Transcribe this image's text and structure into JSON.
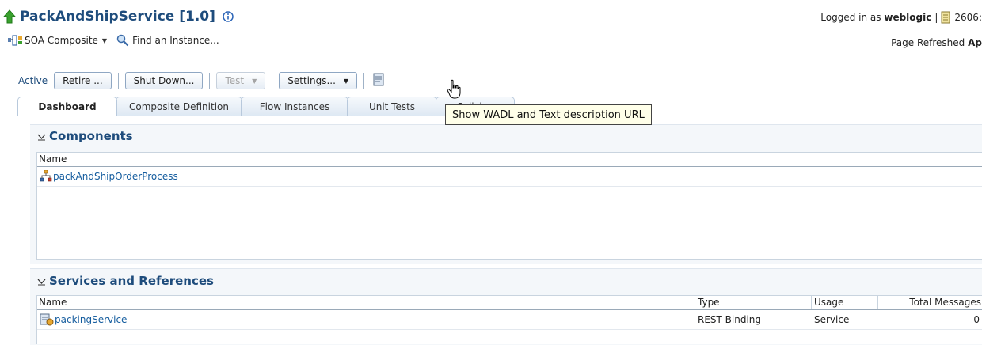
{
  "header": {
    "title": "PackAndShipService [1.0]",
    "composite_menu": "SOA Composite",
    "find_instance": "Find an Instance...",
    "logged_in_prefix": "Logged in as",
    "user": "weblogic",
    "session_id": "2606:",
    "page_refreshed_prefix": "Page Refreshed",
    "page_refreshed_value": "Ap"
  },
  "toolbar": {
    "state": "Active",
    "retire": "Retire ...",
    "shutdown": "Shut Down...",
    "test": "Test",
    "settings": "Settings..."
  },
  "tooltip": "Show WADL and Text description URL",
  "tabs": [
    "Dashboard",
    "Composite Definition",
    "Flow Instances",
    "Unit Tests",
    "Policies"
  ],
  "components": {
    "title": "Components",
    "column_name": "Name",
    "rows": [
      {
        "name": "packAndShipOrderProcess"
      }
    ]
  },
  "services": {
    "title": "Services and References",
    "columns": [
      "Name",
      "Type",
      "Usage",
      "Total Messages"
    ],
    "rows": [
      {
        "name": "packingService",
        "type": "REST Binding",
        "usage": "Service",
        "total_messages": "0"
      }
    ]
  },
  "colors": {
    "title": "#1e4c7c",
    "link": "#145c9e",
    "panel_bg": "#f4f7fa",
    "tooltip_bg": "#ffffe9"
  },
  "icons": {
    "title": "green-up-arrow",
    "info": "info-circle",
    "composite": "composite-icon",
    "find": "magnifier",
    "toolbar_wadl": "document-url-icon",
    "component": "bpel-process-icon",
    "service": "rest-service-icon"
  }
}
